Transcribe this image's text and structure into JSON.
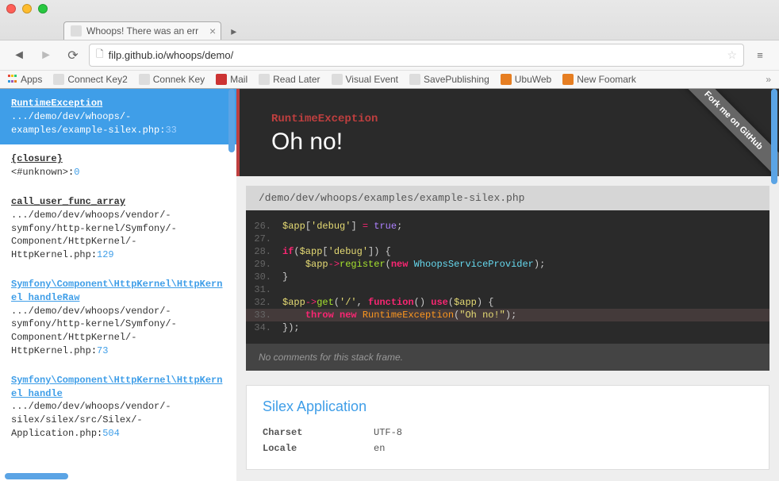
{
  "browser": {
    "tab_title": "Whoops! There was an err",
    "url": "filp.github.io/whoops/demo/",
    "bookmarks": [
      "Apps",
      "Connect Key2",
      "Connek Key",
      "Mail",
      "Read Later",
      "Visual Event",
      "SavePublishing",
      "UbuWeb",
      "New Foomark"
    ]
  },
  "frames": [
    {
      "title": "RuntimeException",
      "path": ".../demo/dev/whoops/-examples/example-silex.php",
      "line": "33",
      "active": true
    },
    {
      "title": "{closure}",
      "path": "<#unknown>",
      "line": "0",
      "titleBlack": true
    },
    {
      "title": "call_user_func_array",
      "path": ".../demo/dev/whoops/vendor/-symfony/http-kernel/Symfony/-Component/HttpKernel/-HttpKernel.php",
      "line": "129",
      "titleBlack": true
    },
    {
      "title": "Symfony\\Component\\HttpKernel\\HttpKernel handleRaw",
      "path": ".../demo/dev/whoops/vendor/-symfony/http-kernel/Symfony/-Component/HttpKernel/-HttpKernel.php",
      "line": "73"
    },
    {
      "title": "Symfony\\Component\\HttpKernel\\HttpKernel handle",
      "path": ".../demo/dev/whoops/vendor/-silex/silex/src/Silex/-Application.php",
      "line": "504"
    }
  ],
  "error": {
    "type": "RuntimeException",
    "message": "Oh no!",
    "ribbon": "Fork me on GitHub",
    "file_path": "/demo/dev/whoops/examples/example-silex.php"
  },
  "code": [
    {
      "n": "26.",
      "html": "<span class='tok-var'>$app</span><span class='tok-plain'>[</span><span class='tok-str'>'debug'</span><span class='tok-plain'>] </span><span class='tok-red'>=</span><span class='tok-plain'> </span><span class='tok-bool'>true</span><span class='tok-plain'>;</span>"
    },
    {
      "n": "27.",
      "html": ""
    },
    {
      "n": "28.",
      "html": "<span class='tok-kw'>if</span><span class='tok-plain'>(</span><span class='tok-var'>$app</span><span class='tok-plain'>[</span><span class='tok-str'>'debug'</span><span class='tok-plain'>]) {</span>"
    },
    {
      "n": "29.",
      "html": "    <span class='tok-var'>$app</span><span class='tok-red'>-></span><span class='tok-func'>register</span><span class='tok-plain'>(</span><span class='tok-kw'>new</span><span class='tok-plain'> </span><span class='tok-class'>WhoopsServiceProvider</span><span class='tok-plain'>);</span>"
    },
    {
      "n": "30.",
      "html": "<span class='tok-plain'>}</span>"
    },
    {
      "n": "31.",
      "html": ""
    },
    {
      "n": "32.",
      "html": "<span class='tok-var'>$app</span><span class='tok-red'>-></span><span class='tok-func'>get</span><span class='tok-plain'>(</span><span class='tok-str'>'/'</span><span class='tok-plain'>, </span><span class='tok-kw'>function</span><span class='tok-plain'>() </span><span class='tok-kw'>use</span><span class='tok-plain'>(</span><span class='tok-var'>$app</span><span class='tok-plain'>) {</span>"
    },
    {
      "n": "33.",
      "html": "    <span class='tok-kw'>throw</span><span class='tok-plain'> </span><span class='tok-kw'>new</span><span class='tok-plain'> </span><span class='tok-orange'>RuntimeException</span><span class='tok-plain'>(</span><span class='tok-str'>\"Oh no!\"</span><span class='tok-plain'>);</span>",
      "hl": true
    },
    {
      "n": "34.",
      "html": "<span class='tok-plain'>});</span>"
    }
  ],
  "comments": "No comments for this stack frame.",
  "env": {
    "title": "Silex Application",
    "rows": [
      {
        "k": "Charset",
        "v": "UTF-8"
      },
      {
        "k": "Locale",
        "v": "en"
      }
    ]
  }
}
